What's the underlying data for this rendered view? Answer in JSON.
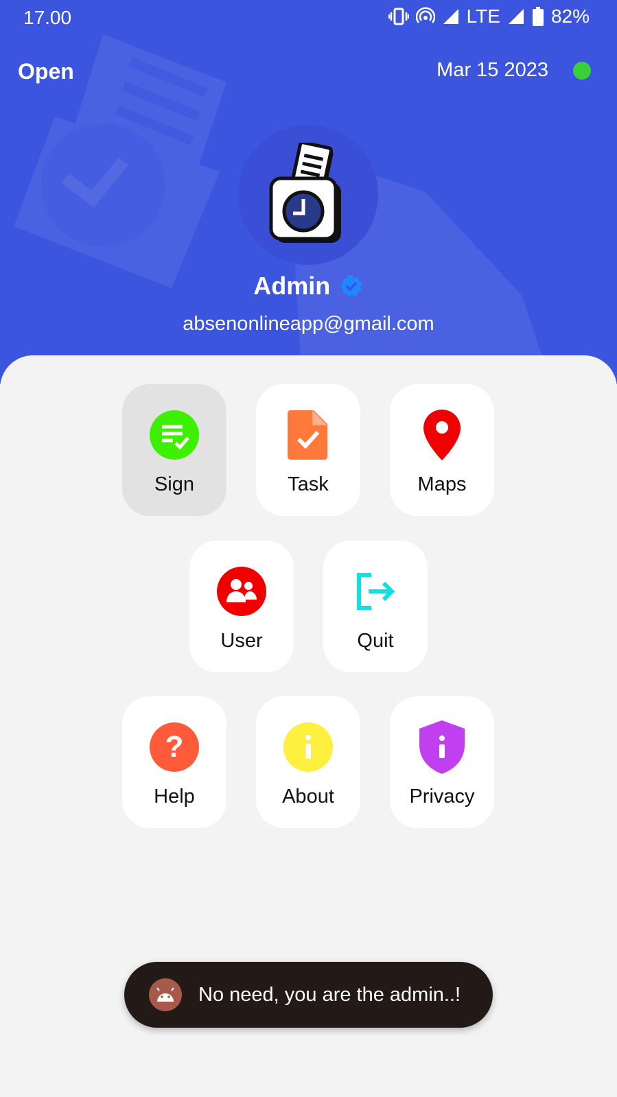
{
  "status_bar": {
    "time": "17.00",
    "network": "LTE",
    "battery": "82%"
  },
  "header": {
    "status_label": "Open",
    "date": "Mar 15 2023",
    "online_color": "#39d139",
    "background_color": "#3b55df"
  },
  "profile": {
    "name": "Admin",
    "email": "absenonlineapp@gmail.com",
    "verified_icon": "verified-badge-icon"
  },
  "menu": {
    "items": [
      {
        "label": "Sign",
        "icon": "sign-list-check-icon",
        "color": "#3cf000"
      },
      {
        "label": "Task",
        "icon": "task-file-check-icon",
        "color": "#ff7a3a"
      },
      {
        "label": "Maps",
        "icon": "map-pin-icon",
        "color": "#f00000"
      },
      {
        "label": "User",
        "icon": "users-icon",
        "color": "#f00000"
      },
      {
        "label": "Quit",
        "icon": "logout-icon",
        "color": "#10e0e0"
      },
      {
        "label": "Help",
        "icon": "help-question-icon",
        "color": "#ff5a3a"
      },
      {
        "label": "About",
        "icon": "info-icon",
        "color": "#fff040"
      },
      {
        "label": "Privacy",
        "icon": "privacy-shield-icon",
        "color": "#c040f0"
      }
    ]
  },
  "toast": {
    "message": "No need, you are the admin..!",
    "icon": "android-icon"
  }
}
